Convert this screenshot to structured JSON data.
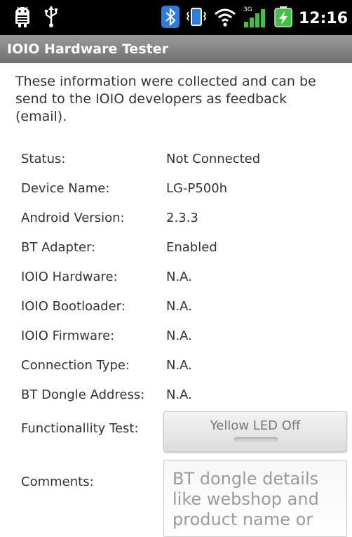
{
  "statusbar": {
    "left_icons": [
      "android-icon",
      "usb-icon"
    ],
    "right_icons": [
      "bluetooth-icon",
      "vibrate-icon",
      "wifi-icon",
      "signal-3g-icon",
      "battery-charging-icon"
    ],
    "network": "3G",
    "time": "12:16"
  },
  "app": {
    "title": "IOIO Hardware Tester"
  },
  "intro": "These information were collected and can be send to the IOIO developers as feedback (email).",
  "fields": [
    {
      "label": "Status:",
      "value": "Not Connected"
    },
    {
      "label": "Device Name:",
      "value": "LG-P500h"
    },
    {
      "label": "Android Version:",
      "value": "2.3.3"
    },
    {
      "label": "BT Adapter:",
      "value": "Enabled"
    },
    {
      "label": "IOIO Hardware:",
      "value": "N.A."
    },
    {
      "label": "IOIO Bootloader:",
      "value": "N.A."
    },
    {
      "label": "IOIO Firmware:",
      "value": "N.A."
    },
    {
      "label": "Connection Type:",
      "value": "N.A."
    },
    {
      "label": "BT Dongle Address:",
      "value": "N.A."
    }
  ],
  "functionality_test": {
    "label": "Functionallity Test:",
    "button": "Yellow LED Off"
  },
  "comments": {
    "label": "Comments:",
    "placeholder": "BT dongle details like webshop and product name or"
  },
  "colors": {
    "statusbar_bg": "#000000",
    "titlebar_bg": "#808080",
    "bt_blue": "#2a7de1",
    "signal_green": "#3cc43c"
  }
}
